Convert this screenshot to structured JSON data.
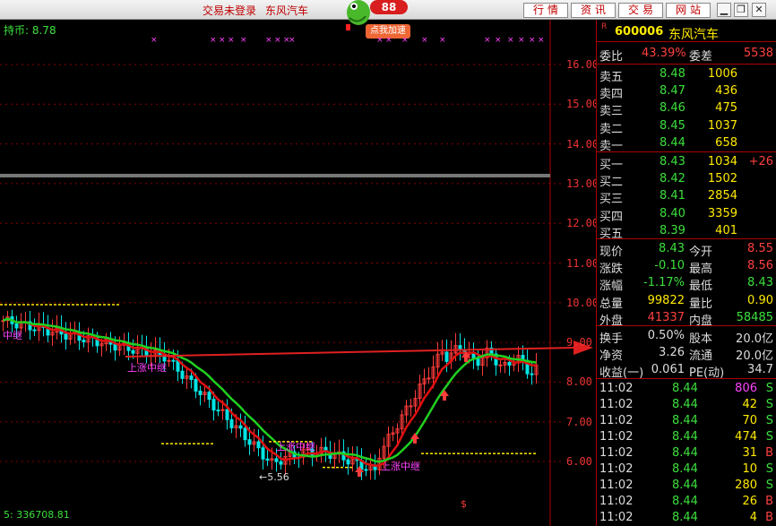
{
  "titlebar": {
    "notice": "交易未登录",
    "stock_name": "东风汽车",
    "badge": "88",
    "speed_label": "点我加速",
    "buttons": [
      "行情",
      "资讯",
      "交易",
      "网站"
    ]
  },
  "chart": {
    "hold_label": "持币: 8.78",
    "volume_label": "5: 336708.81",
    "low_label": "5.56",
    "signal_text": "上涨中继",
    "y_ticks": [
      "16.00",
      "15.00",
      "14.00",
      "13.00",
      "12.00",
      "11.00",
      "10.00",
      "9.00",
      "8.00",
      "7.00",
      "6.00"
    ],
    "colors": {
      "up": "#ff3b3b",
      "down": "#00e5e5",
      "ma_fast": "#e01010",
      "ma_slow": "#20d020",
      "grid": "#8b0000"
    }
  },
  "panel": {
    "r_flag": "R",
    "code": "600006",
    "name": "东风汽车",
    "weibi_label": "委比",
    "weibi": "43.39%",
    "weicha_label": "委差",
    "weicha": "5538",
    "sells": [
      {
        "label": "卖五",
        "price": "8.48",
        "vol": "1006"
      },
      {
        "label": "卖四",
        "price": "8.47",
        "vol": "436"
      },
      {
        "label": "卖三",
        "price": "8.46",
        "vol": "475"
      },
      {
        "label": "卖二",
        "price": "8.45",
        "vol": "1037"
      },
      {
        "label": "卖一",
        "price": "8.44",
        "vol": "658"
      }
    ],
    "buys": [
      {
        "label": "买一",
        "price": "8.43",
        "vol": "1034",
        "chg": "+26"
      },
      {
        "label": "买二",
        "price": "8.42",
        "vol": "1502",
        "chg": ""
      },
      {
        "label": "买三",
        "price": "8.41",
        "vol": "2854",
        "chg": ""
      },
      {
        "label": "买四",
        "price": "8.40",
        "vol": "3359",
        "chg": ""
      },
      {
        "label": "买五",
        "price": "8.39",
        "vol": "401",
        "chg": ""
      }
    ],
    "stats": [
      {
        "l1": "现价",
        "v1": "8.43",
        "c1": "green",
        "l2": "今开",
        "v2": "8.55",
        "c2": "red"
      },
      {
        "l1": "涨跌",
        "v1": "-0.10",
        "c1": "green",
        "l2": "最高",
        "v2": "8.56",
        "c2": "red"
      },
      {
        "l1": "涨幅",
        "v1": "-1.17%",
        "c1": "green",
        "l2": "最低",
        "v2": "8.43",
        "c2": "green"
      },
      {
        "l1": "总量",
        "v1": "99822",
        "c1": "yellow",
        "l2": "量比",
        "v2": "0.90",
        "c2": "yellow"
      },
      {
        "l1": "外盘",
        "v1": "41337",
        "c1": "red",
        "l2": "内盘",
        "v2": "58485",
        "c2": "green"
      }
    ],
    "stats2": [
      {
        "l1": "换手",
        "v1": "0.50%",
        "l2": "股本",
        "v2": "20.0亿"
      },
      {
        "l1": "净资",
        "v1": "3.26",
        "l2": "流通",
        "v2": "20.0亿"
      },
      {
        "l1": "收益(一)",
        "v1": "0.061",
        "l2": "PE(动)",
        "v2": "34.7"
      }
    ],
    "ticks": [
      {
        "time": "11:02",
        "price": "8.44",
        "vol": "806",
        "side": "S"
      },
      {
        "time": "11:02",
        "price": "8.44",
        "vol": "42",
        "side": "S"
      },
      {
        "time": "11:02",
        "price": "8.44",
        "vol": "70",
        "side": "S"
      },
      {
        "time": "11:02",
        "price": "8.44",
        "vol": "474",
        "side": "S"
      },
      {
        "time": "11:02",
        "price": "8.44",
        "vol": "31",
        "side": "B"
      },
      {
        "time": "11:02",
        "price": "8.44",
        "vol": "10",
        "side": "S"
      },
      {
        "time": "11:02",
        "price": "8.44",
        "vol": "280",
        "side": "S"
      },
      {
        "time": "11:02",
        "price": "8.44",
        "vol": "26",
        "side": "B"
      },
      {
        "time": "11:02",
        "price": "8.44",
        "vol": "4",
        "side": "B"
      }
    ]
  }
}
